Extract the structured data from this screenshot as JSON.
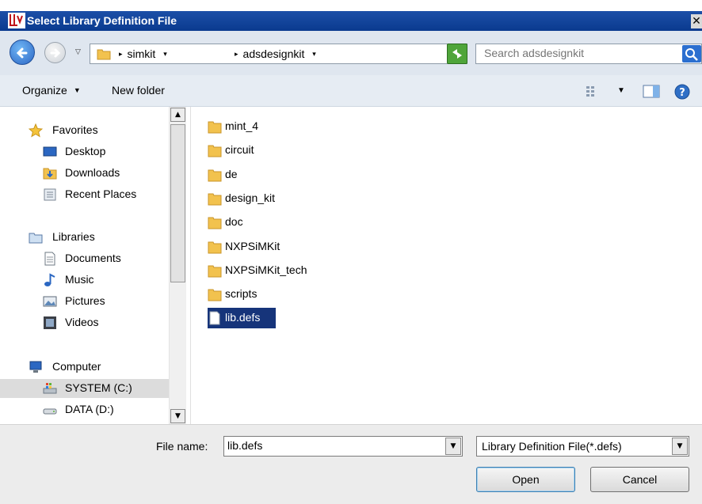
{
  "window": {
    "title": "Select Library Definition File",
    "close_glyph": "✕"
  },
  "address": {
    "crumbs": [
      "simkit",
      "adsdesignkit"
    ],
    "search_placeholder": "Search adsdesignkit"
  },
  "toolbar": {
    "organize_label": "Organize",
    "new_folder_label": "New folder"
  },
  "nav": {
    "favorites": {
      "label": "Favorites",
      "items": [
        "Desktop",
        "Downloads",
        "Recent Places"
      ]
    },
    "libraries": {
      "label": "Libraries",
      "items": [
        "Documents",
        "Music",
        "Pictures",
        "Videos"
      ]
    },
    "computer": {
      "label": "Computer",
      "items": [
        "SYSTEM (C:)",
        "DATA (D:)"
      ]
    },
    "selected_item": "SYSTEM (C:)"
  },
  "files": [
    {
      "name": "mint_4",
      "type": "folder"
    },
    {
      "name": "circuit",
      "type": "folder"
    },
    {
      "name": "de",
      "type": "folder"
    },
    {
      "name": "design_kit",
      "type": "folder"
    },
    {
      "name": "doc",
      "type": "folder"
    },
    {
      "name": "NXPSiMKit",
      "type": "folder"
    },
    {
      "name": "NXPSiMKit_tech",
      "type": "folder"
    },
    {
      "name": "scripts",
      "type": "folder"
    },
    {
      "name": "lib.defs",
      "type": "file",
      "selected": true
    }
  ],
  "footer": {
    "file_name_label": "File name:",
    "file_name_value": "lib.defs",
    "file_type": "Library Definition File(*.defs)",
    "open_label": "Open",
    "cancel_label": "Cancel"
  },
  "colors": {
    "titlebar": "#1c4fa8",
    "selection": "#16347a",
    "folder": "#f2c24e"
  }
}
